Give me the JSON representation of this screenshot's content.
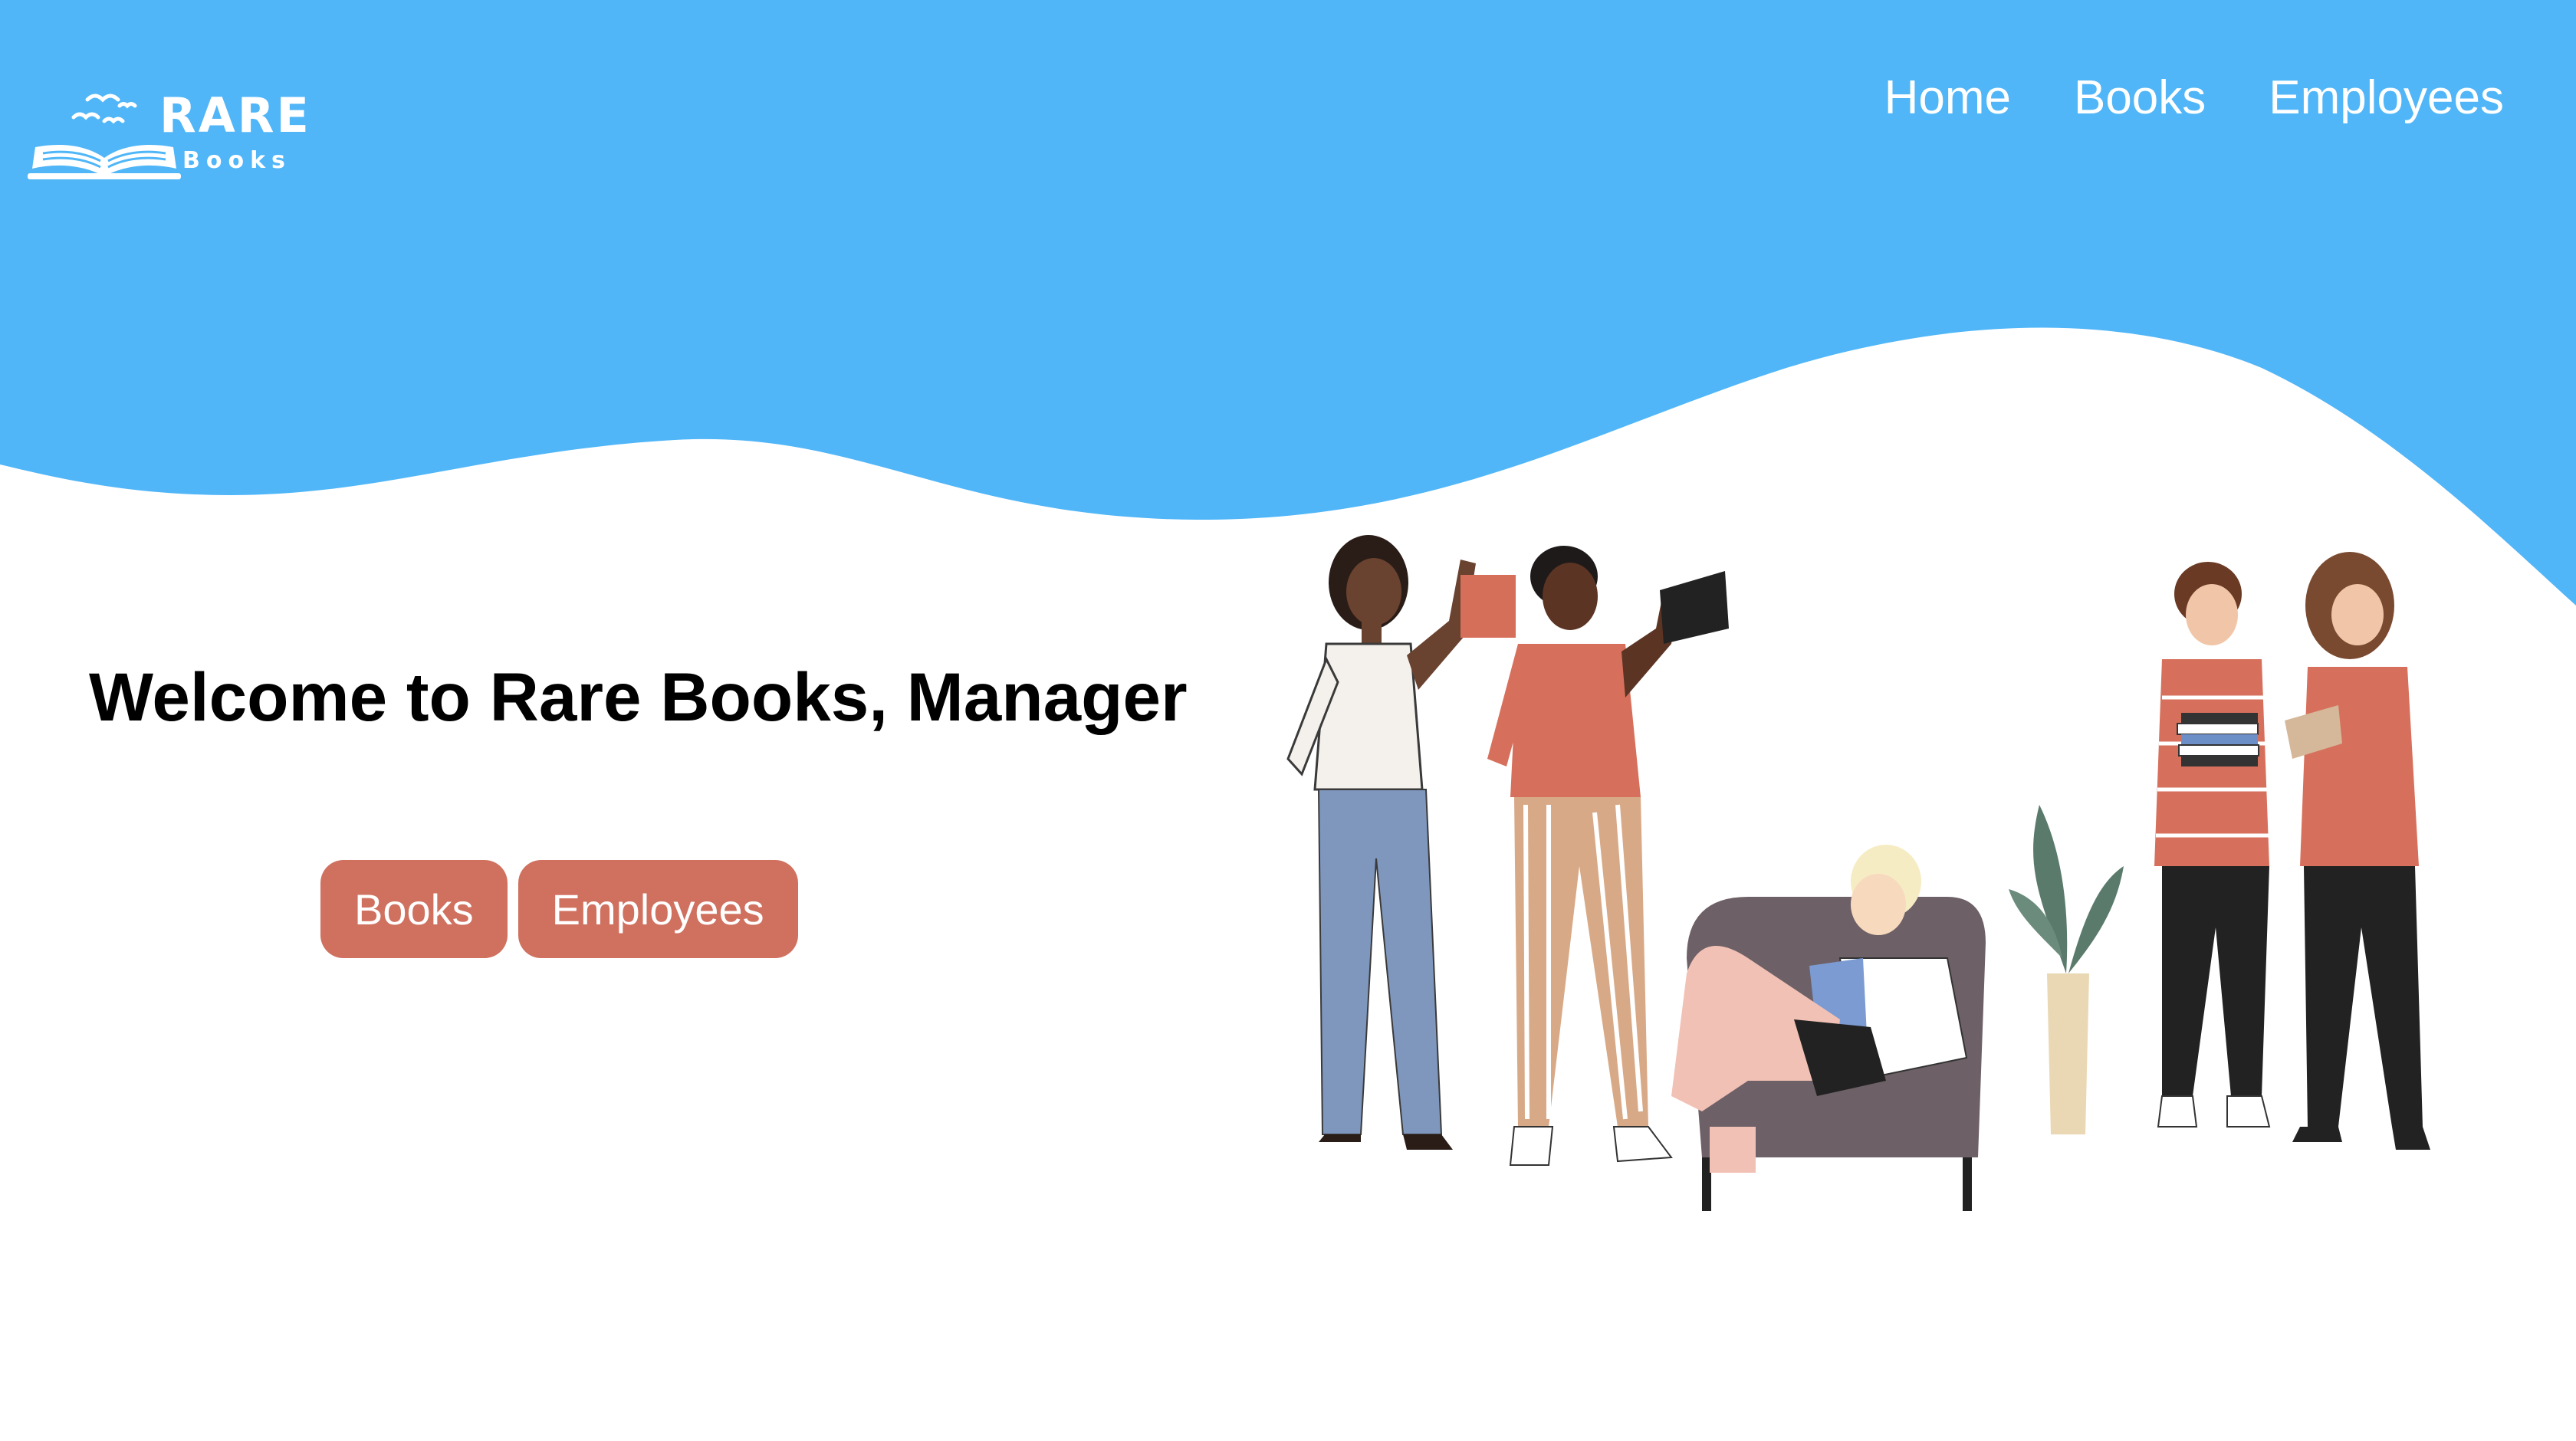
{
  "brand": {
    "title": "RARE",
    "subtitle": "Books"
  },
  "nav": {
    "items": [
      "Home",
      "Books",
      "Employees"
    ]
  },
  "hero": {
    "heading": "Welcome to Rare Books, Manager",
    "buttons": [
      "Books",
      "Employees"
    ]
  },
  "colors": {
    "hero_blue": "#50b6f8",
    "button": "#d0705f",
    "text": "#000000"
  },
  "icons": [
    "open-book-logo-icon",
    "birds-icon"
  ]
}
